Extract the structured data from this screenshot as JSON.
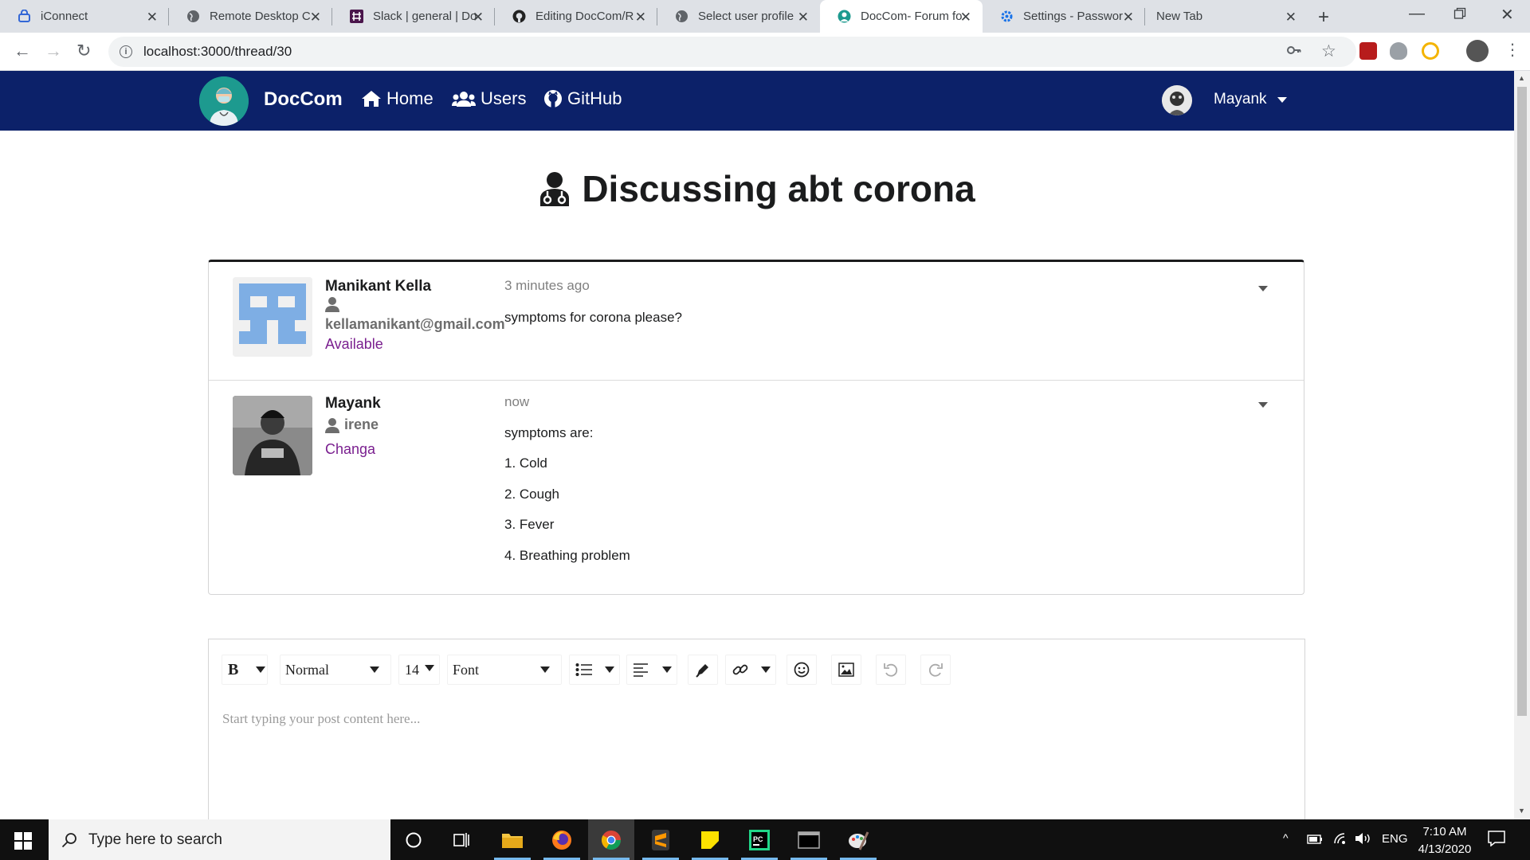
{
  "browser": {
    "tabs": [
      {
        "title": "iConnect",
        "icon": "iconnect-icon"
      },
      {
        "title": "Remote Desktop C",
        "icon": "globe-icon"
      },
      {
        "title": "Slack | general | Do",
        "icon": "slack-icon"
      },
      {
        "title": "Editing DocCom/R",
        "icon": "github-icon"
      },
      {
        "title": "Select user profile",
        "icon": "globe-icon"
      },
      {
        "title": "DocCom- Forum fo",
        "icon": "doccom-icon"
      },
      {
        "title": "Settings - Passwor",
        "icon": "gear-icon"
      },
      {
        "title": "New Tab",
        "icon": ""
      }
    ],
    "active_tab_index": 5,
    "url": "localhost:3000/thread/30"
  },
  "navbar": {
    "brand": "DocCom",
    "links": [
      "Home",
      "Users",
      "GitHub"
    ],
    "user_name": "Mayank",
    "bg_color": "#0c2169"
  },
  "thread": {
    "title": "Discussing abt corona",
    "posts": [
      {
        "author": "Manikant Kella",
        "handle": "kellamanikant@gmail.com",
        "status": "Available",
        "time": "3 minutes ago",
        "lines": [
          "symptoms for corona please?"
        ]
      },
      {
        "author": "Mayank",
        "handle": "irene",
        "status": "Changa",
        "time": "now",
        "lines": [
          "symptoms are:",
          "1. Cold",
          "2. Cough",
          "3. Fever",
          "4. Breathing problem"
        ]
      }
    ]
  },
  "editor": {
    "bold_label": "B",
    "block_type": "Normal",
    "font_size": "14",
    "font_family": "Font",
    "placeholder": "Start typing your post content here..."
  },
  "taskbar": {
    "search_placeholder": "Type here to search",
    "language": "ENG",
    "time": "7:10 AM",
    "date": "4/13/2020"
  }
}
